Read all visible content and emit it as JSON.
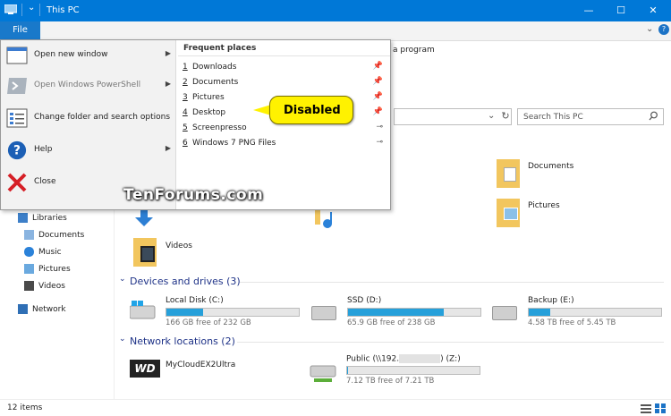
{
  "window": {
    "title": "This PC",
    "minimize_glyph": "—",
    "maximize_glyph": "☐",
    "close_glyph": "✕",
    "help_glyph": "?",
    "expand_glyph": "⌄"
  },
  "ribbon": {
    "file_tab": "File",
    "partial_label": "a program"
  },
  "address": {
    "refresh_glyph": "↻",
    "dropdown_glyph": "⌄",
    "search_placeholder": "Search This PC"
  },
  "file_menu": {
    "items": [
      {
        "label": "Open new window",
        "has_submenu": true,
        "icon": "window-icon"
      },
      {
        "label": "Open Windows PowerShell",
        "has_submenu": true,
        "icon": "powershell-icon"
      },
      {
        "label": "Change folder and search options",
        "has_submenu": false,
        "icon": "options-icon"
      },
      {
        "label": "Help",
        "has_submenu": true,
        "icon": "help-icon"
      },
      {
        "label": "Close",
        "has_submenu": false,
        "icon": "close-icon"
      }
    ],
    "frequent_title": "Frequent places",
    "frequent": [
      {
        "num": "1",
        "label": "Downloads",
        "pinned": true
      },
      {
        "num": "2",
        "label": "Documents",
        "pinned": true
      },
      {
        "num": "3",
        "label": "Pictures",
        "pinned": true
      },
      {
        "num": "4",
        "label": "Desktop",
        "pinned": true
      },
      {
        "num": "5",
        "label": "Screenpresso",
        "pinned": false
      },
      {
        "num": "6",
        "label": "Windows 7 PNG Files",
        "pinned": false
      }
    ]
  },
  "callout": {
    "text": "Disabled"
  },
  "watermark": {
    "text": "TenForums.com"
  },
  "nav": {
    "items": [
      {
        "label": "Libraries",
        "icon": "libraries-icon",
        "color": "#3d7fc8"
      },
      {
        "label": "Documents",
        "icon": "documents-icon",
        "color": "#8ab4e0"
      },
      {
        "label": "Music",
        "icon": "music-icon",
        "color": "#2b82d9"
      },
      {
        "label": "Pictures",
        "icon": "pictures-icon",
        "color": "#6aa9df"
      },
      {
        "label": "Videos",
        "icon": "videos-icon",
        "color": "#4a4a4a"
      },
      {
        "label": "Network",
        "icon": "network-icon",
        "color": "#2f6fb5"
      }
    ]
  },
  "folders": [
    {
      "label": "Documents"
    },
    {
      "label": "Pictures"
    },
    {
      "label": "Videos"
    }
  ],
  "devices": {
    "header": "Devices and drives (3)",
    "drives": [
      {
        "name": "Local Disk (C:)",
        "free": "166 GB free of 232 GB",
        "used_fraction": 0.28
      },
      {
        "name": "SSD (D:)",
        "free": "65.9 GB free of 238 GB",
        "used_fraction": 0.72
      },
      {
        "name": "Backup (E:)",
        "free": "4.58 TB free of 5.45 TB",
        "used_fraction": 0.16
      }
    ]
  },
  "network": {
    "header": "Network locations (2)",
    "locations": [
      {
        "name": "MyCloudEX2Ultra",
        "logo": "WD"
      },
      {
        "name_prefix": "Public (\\\\192.",
        "name_suffix": ") (Z:)",
        "free": "7.12 TB free of 7.21 TB",
        "used_fraction": 0.01
      }
    ]
  },
  "status": {
    "count": "12 items"
  },
  "colors": {
    "accent": "#0078d7",
    "file_tab": "#1979ca",
    "callout": "#fff200",
    "drive_bar": "#26a0da"
  }
}
